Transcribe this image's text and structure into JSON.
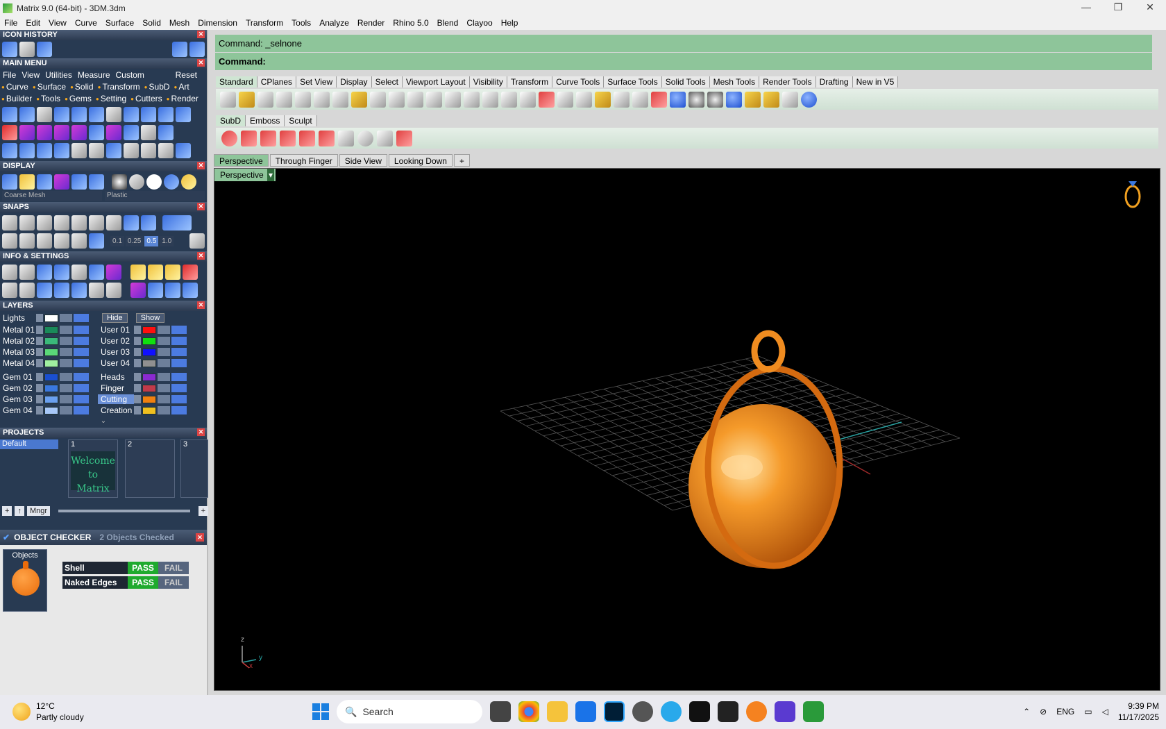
{
  "window": {
    "title": "Matrix 9.0 (64-bit) - 3DM.3dm",
    "controls": [
      "—",
      "❐",
      "✕"
    ]
  },
  "menubar": [
    "File",
    "Edit",
    "View",
    "Curve",
    "Surface",
    "Solid",
    "Mesh",
    "Dimension",
    "Transform",
    "Tools",
    "Analyze",
    "Render",
    "Rhino 5.0",
    "Blend",
    "Clayoo",
    "Help"
  ],
  "left": {
    "icon_history": "ICON HISTORY",
    "main_menu": "MAIN MENU",
    "main_tabs": [
      "File",
      "View",
      "Utilities",
      "Measure",
      "Custom"
    ],
    "reset": "Reset",
    "categories": [
      "Curve",
      "Surface",
      "Solid",
      "Transform",
      "SubD",
      "Art",
      "Builder",
      "Tools",
      "Gems",
      "Setting",
      "Cutters",
      "Render"
    ],
    "display": "DISPLAY",
    "display_mesh": "Coarse Mesh",
    "display_material": "Plastic",
    "snaps": "SNAPS",
    "snap_values": [
      "0.1",
      "0.25",
      "0.5",
      "1.0"
    ],
    "info_settings": "INFO & SETTINGS",
    "layers_title": "LAYERS",
    "lights": "Lights",
    "hide": "Hide",
    "show": "Show",
    "layers_left": [
      {
        "name": "Metal 01",
        "color": "#1a8a5a"
      },
      {
        "name": "Metal 02",
        "color": "#3ab87a"
      },
      {
        "name": "Metal 03",
        "color": "#5ad878"
      },
      {
        "name": "Metal 04",
        "color": "#a0f0a0"
      },
      {
        "name": "Gem 01",
        "color": "#1a4fd0"
      },
      {
        "name": "Gem 02",
        "color": "#3a78e0"
      },
      {
        "name": "Gem 03",
        "color": "#6aa0f0"
      },
      {
        "name": "Gem 04",
        "color": "#a8c8f8"
      }
    ],
    "layers_right": [
      {
        "name": "User 01",
        "color": "#ff1010"
      },
      {
        "name": "User 02",
        "color": "#10e010"
      },
      {
        "name": "User 03",
        "color": "#1010ff"
      },
      {
        "name": "User 04",
        "color": "#909090"
      },
      {
        "name": "Heads",
        "color": "#8a2ad0"
      },
      {
        "name": "Finger",
        "color": "#c03a4a"
      },
      {
        "name": "Cutting",
        "color": "#f08010"
      },
      {
        "name": "Creation",
        "color": "#f0c020"
      }
    ],
    "projects_title": "PROJECTS",
    "project_default": "Default",
    "project_slots": [
      "1",
      "2",
      "3"
    ],
    "welcome": "Welcome to Matrix",
    "mngr": "Mngr",
    "checker_title": "OBJECT CHECKER",
    "checker_count": "2 Objects Checked",
    "objects_label": "Objects",
    "checks": [
      {
        "label": "Shell",
        "pass": "PASS",
        "fail": "FAIL"
      },
      {
        "label": "Naked Edges",
        "pass": "PASS",
        "fail": "FAIL"
      }
    ]
  },
  "command": {
    "history": "Command: _selnone",
    "prompt": "Command:"
  },
  "toolbar_tabs": [
    "Standard",
    "CPlanes",
    "Set View",
    "Display",
    "Select",
    "Viewport Layout",
    "Visibility",
    "Transform",
    "Curve Tools",
    "Surface Tools",
    "Solid Tools",
    "Mesh Tools",
    "Render Tools",
    "Drafting",
    "New in V5"
  ],
  "sub_tabs": [
    "SubD",
    "Emboss",
    "Sculpt"
  ],
  "viewport_tabs": [
    "Perspective",
    "Through Finger",
    "Side View",
    "Looking Down",
    "+"
  ],
  "viewport_label": "Perspective",
  "axis_labels": {
    "z": "z",
    "y": "y",
    "x": "x"
  },
  "taskbar": {
    "temp": "12°C",
    "weather": "Partly cloudy",
    "search": "Search",
    "lang": "ENG",
    "time": "9:39 PM",
    "date": "11/17/2025"
  },
  "colors": {
    "accent_green": "#8ec59a",
    "panel_dark": "#283a52",
    "pendant": "#ea6c0a"
  }
}
